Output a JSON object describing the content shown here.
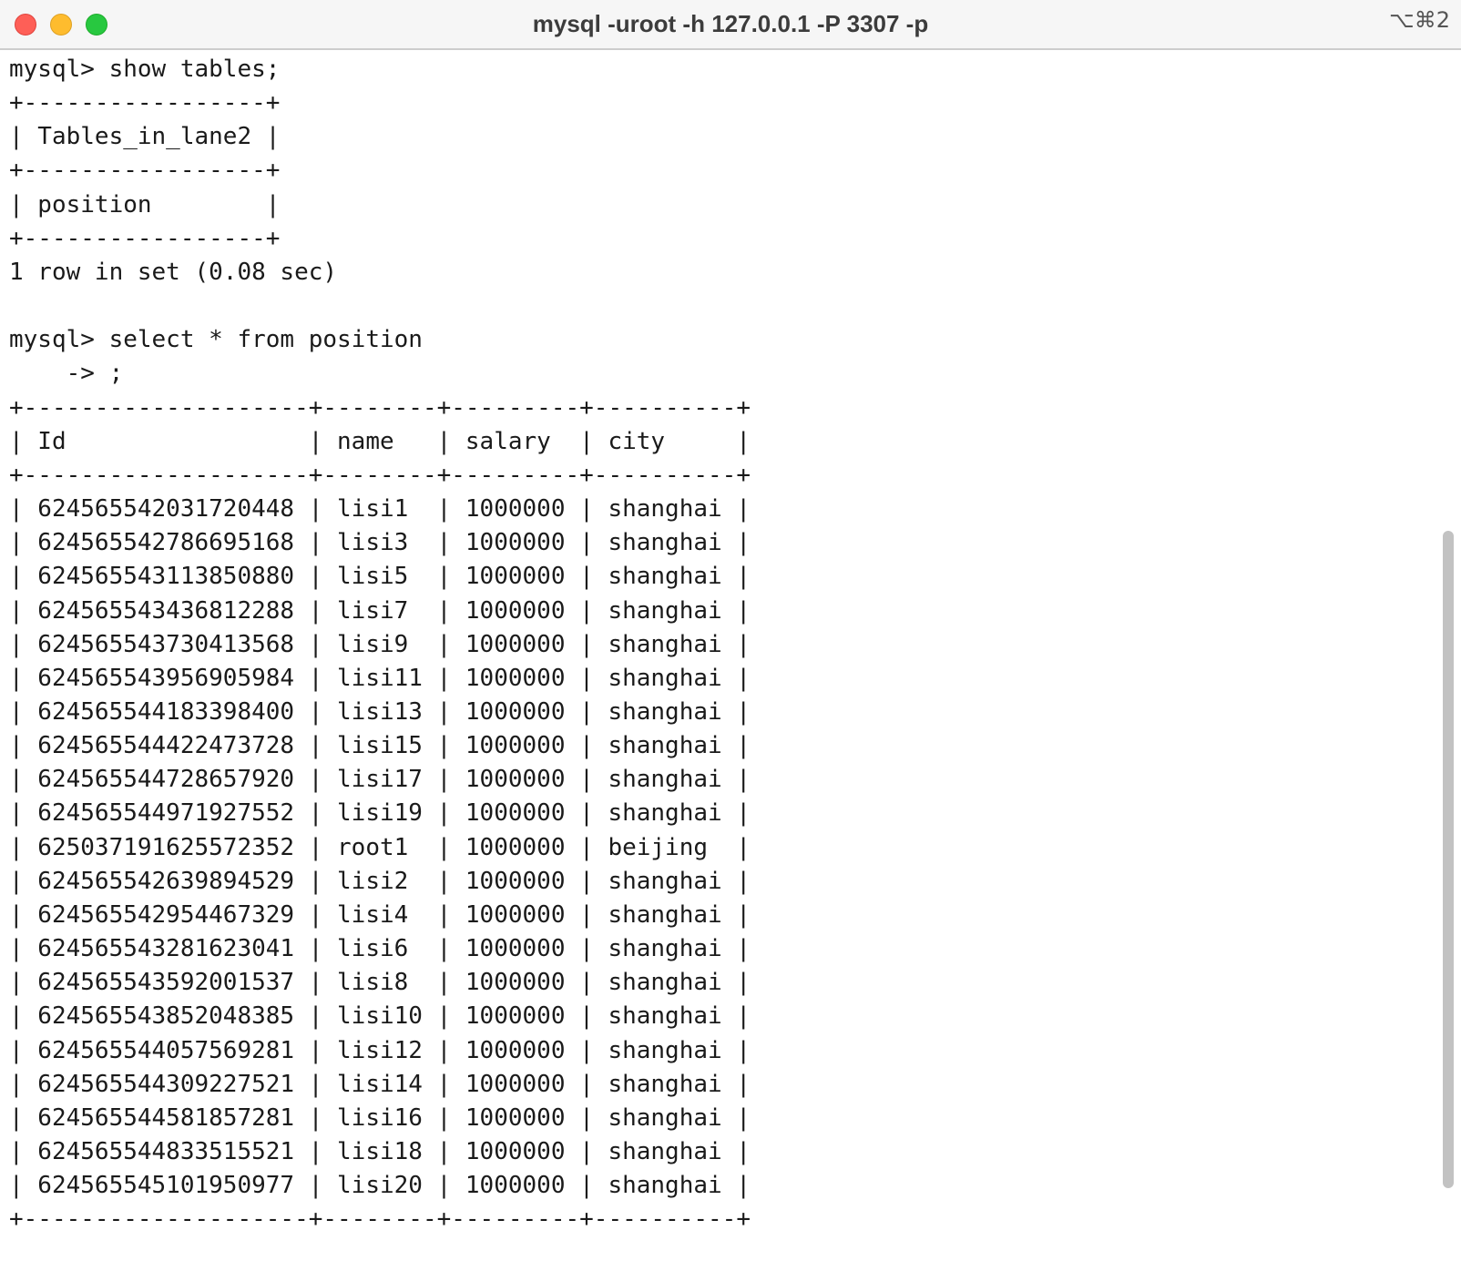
{
  "window": {
    "title": "mysql -uroot -h 127.0.0.1 -P 3307 -p",
    "shortcut": "⌥⌘2"
  },
  "terminal": {
    "lines": [
      "mysql> show tables;",
      "+-----------------+",
      "| Tables_in_lane2 |",
      "+-----------------+",
      "| position        |",
      "+-----------------+",
      "1 row in set (0.08 sec)",
      "",
      "mysql> select * from position",
      "    -> ;",
      "+--------------------+--------+---------+----------+",
      "| Id                 | name   | salary  | city     |",
      "+--------------------+--------+---------+----------+",
      "| 624565542031720448 | lisi1  | 1000000 | shanghai |",
      "| 624565542786695168 | lisi3  | 1000000 | shanghai |",
      "| 624565543113850880 | lisi5  | 1000000 | shanghai |",
      "| 624565543436812288 | lisi7  | 1000000 | shanghai |",
      "| 624565543730413568 | lisi9  | 1000000 | shanghai |",
      "| 624565543956905984 | lisi11 | 1000000 | shanghai |",
      "| 624565544183398400 | lisi13 | 1000000 | shanghai |",
      "| 624565544422473728 | lisi15 | 1000000 | shanghai |",
      "| 624565544728657920 | lisi17 | 1000000 | shanghai |",
      "| 624565544971927552 | lisi19 | 1000000 | shanghai |",
      "| 625037191625572352 | root1  | 1000000 | beijing  |",
      "| 624565542639894529 | lisi2  | 1000000 | shanghai |",
      "| 624565542954467329 | lisi4  | 1000000 | shanghai |",
      "| 624565543281623041 | lisi6  | 1000000 | shanghai |",
      "| 624565543592001537 | lisi8  | 1000000 | shanghai |",
      "| 624565543852048385 | lisi10 | 1000000 | shanghai |",
      "| 624565544057569281 | lisi12 | 1000000 | shanghai |",
      "| 624565544309227521 | lisi14 | 1000000 | shanghai |",
      "| 624565544581857281 | lisi16 | 1000000 | shanghai |",
      "| 624565544833515521 | lisi18 | 1000000 | shanghai |",
      "| 624565545101950977 | lisi20 | 1000000 | shanghai |",
      "+--------------------+--------+---------+----------+"
    ]
  }
}
